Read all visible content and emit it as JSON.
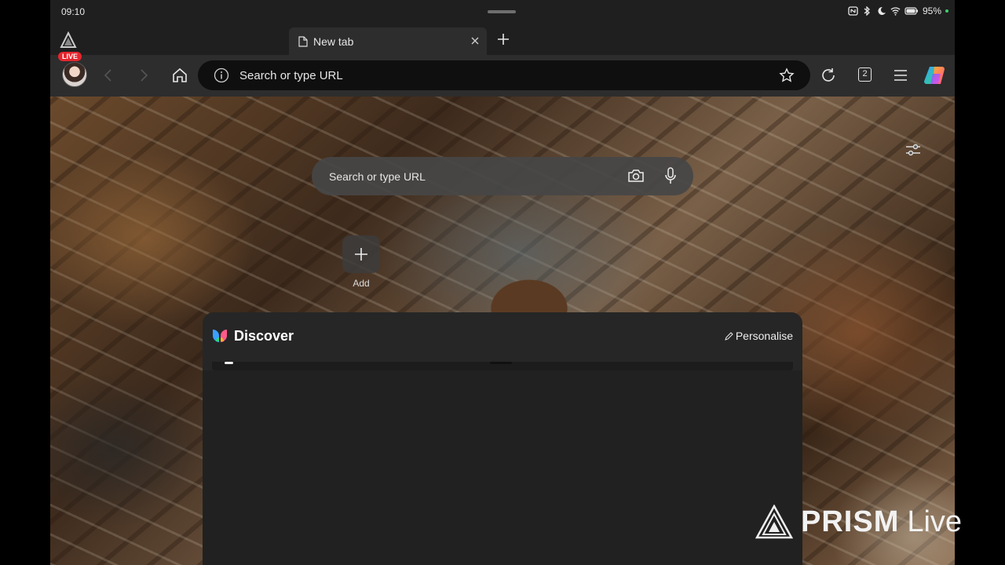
{
  "status_bar": {
    "time": "09:10",
    "battery": "95%",
    "icons": [
      "nfc-icon",
      "bluetooth-icon",
      "moon-icon",
      "wifi-icon",
      "battery-icon"
    ]
  },
  "tab_strip": {
    "live_badge": "LIVE",
    "tabs": [
      {
        "title": "New tab"
      }
    ]
  },
  "toolbar": {
    "omnibox_placeholder": "Search or type URL",
    "tab_count": "2"
  },
  "new_tab_page": {
    "search_placeholder": "Search or type URL",
    "add_tile_label": "Add",
    "discover": {
      "title": "Discover",
      "personalise_label": "Personalise"
    }
  },
  "watermark": {
    "brand": "PRISM",
    "suffix": "Live"
  },
  "colors": {
    "live_red": "#e5262e",
    "battery_dot": "#3ad06a",
    "toolbar_bg": "#2d2d2d",
    "omnibox_bg": "#0f0f0f"
  }
}
